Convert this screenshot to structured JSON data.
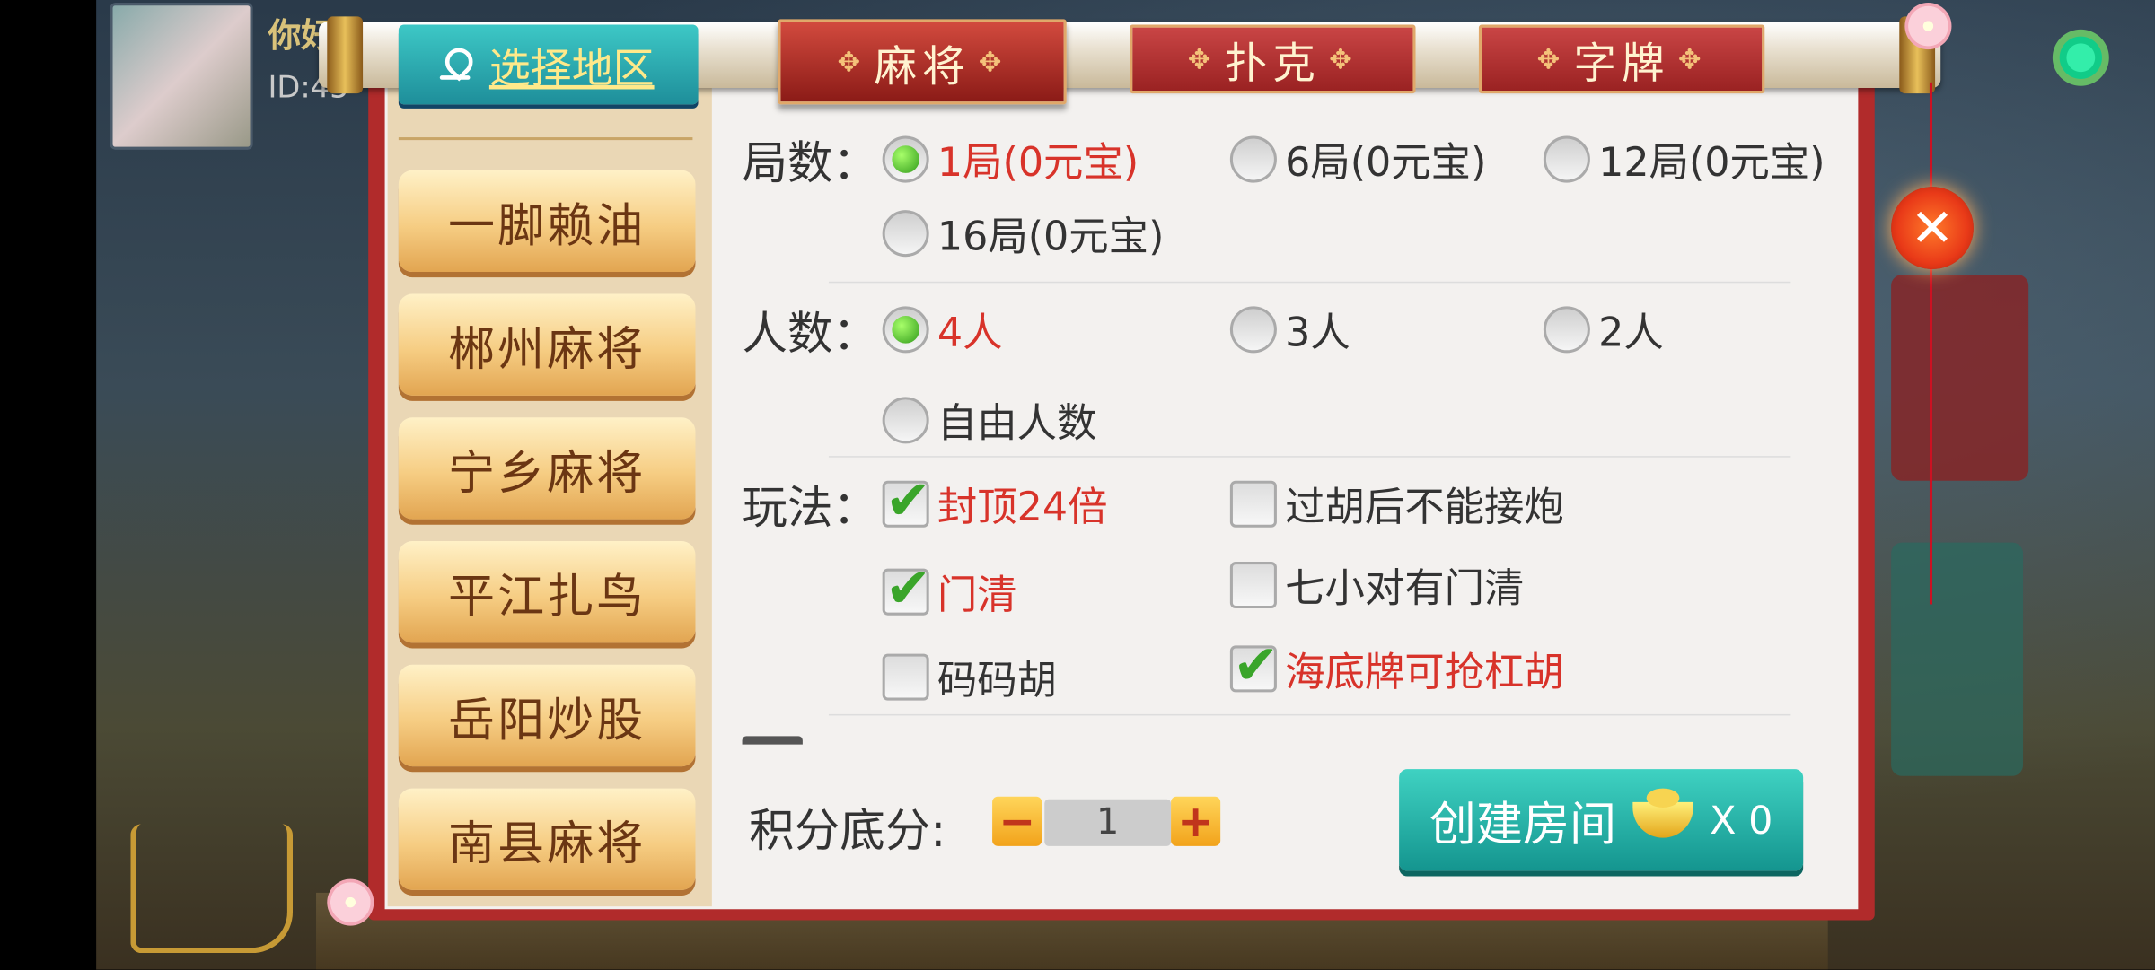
{
  "header": {
    "nickname": "你好",
    "user_id": "ID:45"
  },
  "region_button": {
    "label": "选择地区"
  },
  "category_tabs": [
    {
      "label": "麻将",
      "active": true
    },
    {
      "label": "扑克",
      "active": false
    },
    {
      "label": "字牌",
      "active": false
    }
  ],
  "sidebar_games": [
    "一脚赖油",
    "郴州麻将",
    "宁乡麻将",
    "平江扎鸟",
    "岳阳炒股",
    "南县麻将"
  ],
  "rounds": {
    "label": "局数：",
    "options": [
      "1局(0元宝)",
      "6局(0元宝)",
      "12局(0元宝)",
      "16局(0元宝)"
    ],
    "selected": "1局(0元宝)"
  },
  "players": {
    "label": "人数：",
    "options": [
      "4人",
      "3人",
      "2人",
      "自由人数"
    ],
    "selected": "4人"
  },
  "rules": {
    "label": "玩法：",
    "options": [
      {
        "label": "封顶24倍",
        "checked": true
      },
      {
        "label": "过胡后不能接炮",
        "checked": false
      },
      {
        "label": "门清",
        "checked": true
      },
      {
        "label": "七小对有门清",
        "checked": false
      },
      {
        "label": "码码胡",
        "checked": false
      },
      {
        "label": "海底牌可抢杠胡",
        "checked": true
      }
    ]
  },
  "score": {
    "label": "积分底分:",
    "value": "1",
    "minus": "−",
    "plus": "+"
  },
  "create_button": {
    "label": "创建房间",
    "count": "X 0"
  },
  "close_glyph": "✕",
  "colors": {
    "selected_text": "#d8332a",
    "teal_button": "#1fb0a6",
    "panel_red": "#b12b2b"
  }
}
